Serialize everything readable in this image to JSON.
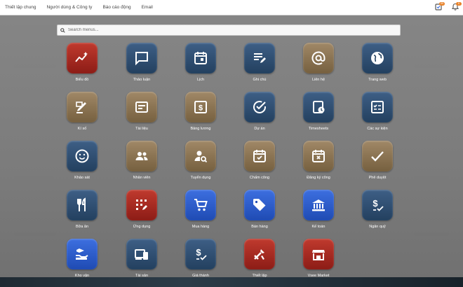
{
  "topbar": {
    "menu": [
      "Thiết lập chung",
      "Người dùng & Công ty",
      "Báo cáo động",
      "Email"
    ],
    "activity_badge": "99",
    "notification_badge": "6"
  },
  "search": {
    "placeholder": "Search menus..."
  },
  "apps": [
    {
      "label": "Biểu đồ",
      "icon": "chart-sparkle-icon",
      "color": "red"
    },
    {
      "label": "Thảo luận",
      "icon": "chat-bubble-icon",
      "color": "navy"
    },
    {
      "label": "Lịch",
      "icon": "calendar-icon",
      "color": "navy"
    },
    {
      "label": "Ghi chú",
      "icon": "note-edit-icon",
      "color": "navy"
    },
    {
      "label": "Liên hệ",
      "icon": "at-sign-icon",
      "color": "brown"
    },
    {
      "label": "Trang web",
      "icon": "globe-icon",
      "color": "navy"
    },
    {
      "label": "Kí số",
      "icon": "sign-pen-icon",
      "color": "brown"
    },
    {
      "label": "Tài liệu",
      "icon": "document-icon",
      "color": "brown"
    },
    {
      "label": "Bảng lương",
      "icon": "payslip-icon",
      "color": "brown"
    },
    {
      "label": "Dự án",
      "icon": "check-circle-icon",
      "color": "navy"
    },
    {
      "label": "Timesheets",
      "icon": "timesheet-icon",
      "color": "navy"
    },
    {
      "label": "Các sự kiện",
      "icon": "event-list-icon",
      "color": "navy"
    },
    {
      "label": "Khảo sát",
      "icon": "smiley-icon",
      "color": "navy"
    },
    {
      "label": "Nhân viên",
      "icon": "people-icon",
      "color": "brown"
    },
    {
      "label": "Tuyển dụng",
      "icon": "person-search-icon",
      "color": "brown"
    },
    {
      "label": "Chấm công",
      "icon": "calendar-check-icon",
      "color": "brown"
    },
    {
      "label": "Đăng ký công",
      "icon": "calendar-cross-icon",
      "color": "brown"
    },
    {
      "label": "Phê duyệt",
      "icon": "checkmark-icon",
      "color": "brown"
    },
    {
      "label": "Bữa ăn",
      "icon": "cutlery-icon",
      "color": "navy"
    },
    {
      "label": "Ứng dụng",
      "icon": "apps-grid-icon",
      "color": "red"
    },
    {
      "label": "Mua hàng",
      "icon": "cart-icon",
      "color": "blue"
    },
    {
      "label": "Bán hàng",
      "icon": "price-tag-icon",
      "color": "blue"
    },
    {
      "label": "Kế toán",
      "icon": "bank-icon",
      "color": "blue"
    },
    {
      "label": "Ngân quỹ",
      "icon": "dollar-check-icon",
      "color": "navy"
    },
    {
      "label": "Kho vận",
      "icon": "inventory-icon",
      "color": "blue"
    },
    {
      "label": "Tài sản",
      "icon": "devices-icon",
      "color": "navy"
    },
    {
      "label": "Giá thành",
      "icon": "dollar-check-icon",
      "color": "navy"
    },
    {
      "label": "Thiết lập",
      "icon": "tools-icon",
      "color": "red"
    },
    {
      "label": "Vsee Market",
      "icon": "store-icon",
      "color": "red"
    }
  ]
}
